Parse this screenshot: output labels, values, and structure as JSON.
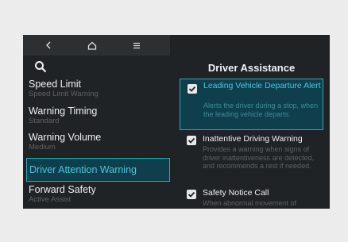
{
  "colors": {
    "screen_bg": "#202326",
    "topbar_bg": "#2d3033",
    "highlight_border": "#2aa7c0",
    "highlight_bg": "#0f3f4c",
    "highlight_text": "#46c7e0",
    "dim_text": "#5d6165"
  },
  "topbar": {
    "icons": [
      "back-icon",
      "home-icon",
      "menu-icon"
    ]
  },
  "search": {
    "icon": "search-icon"
  },
  "menu": {
    "items": [
      {
        "title": "Speed Limit",
        "subtitle": "Speed Limit Warning"
      },
      {
        "title": "Warning Timing",
        "subtitle": "Standard"
      },
      {
        "title": "Warning Volume",
        "subtitle": "Medium"
      },
      {
        "title": "Driver Attention Warning",
        "selected": true
      },
      {
        "title": "Forward Safety",
        "subtitle": "Active Assist"
      }
    ]
  },
  "panel": {
    "title": "Driver Assistance",
    "options": [
      {
        "title": "Leading Vehicle Departure Alert",
        "description": "Alerts the driver during a stop, when the leading vehicle departs.",
        "checked": true,
        "focused": true
      },
      {
        "title": "Inattentive Driving Warning",
        "description": "Provides a warning when signs of driver inattentiveness are detected, and recommends a rest if needed.",
        "checked": true
      },
      {
        "title": "Safety Notice Call",
        "description": "When abnormal movement of",
        "checked": true
      }
    ]
  }
}
